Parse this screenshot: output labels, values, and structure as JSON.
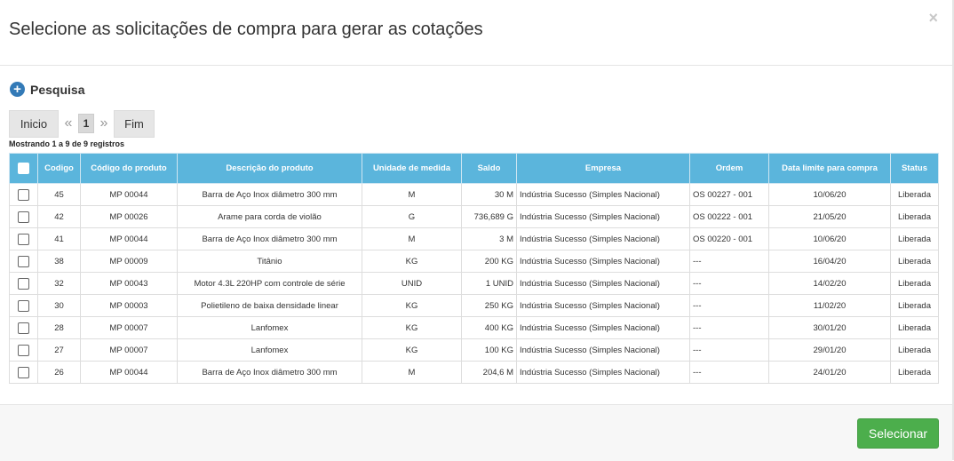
{
  "modal": {
    "title": "Selecione as solicitações de compra para gerar as cotações",
    "close_glyph": "×"
  },
  "search": {
    "label": "Pesquisa",
    "icon": "plus-circle-icon"
  },
  "pager": {
    "first_label": "Inicio",
    "prev_glyph": "«",
    "current_page": "1",
    "next_glyph": "»",
    "last_label": "Fim"
  },
  "showing_text": "Mostrando 1 a 9 de 9 registros",
  "table": {
    "columns": [
      "Codigo",
      "Código do produto",
      "Descrição do produto",
      "Unidade de medida",
      "Saldo",
      "Empresa",
      "Ordem",
      "Data limite para compra",
      "Status"
    ],
    "rows": [
      {
        "codigo": "45",
        "produto": "MP 00044",
        "descricao": "Barra de Aço Inox diâmetro 300 mm",
        "unidade": "M",
        "saldo": "30 M",
        "empresa": "Indústria Sucesso (Simples Nacional)",
        "ordem": "OS 00227 - 001",
        "data": "10/06/20",
        "status": "Liberada"
      },
      {
        "codigo": "42",
        "produto": "MP 00026",
        "descricao": "Arame para corda de violão",
        "unidade": "G",
        "saldo": "736,689 G",
        "empresa": "Indústria Sucesso (Simples Nacional)",
        "ordem": "OS 00222 - 001",
        "data": "21/05/20",
        "status": "Liberada"
      },
      {
        "codigo": "41",
        "produto": "MP 00044",
        "descricao": "Barra de Aço Inox diâmetro 300 mm",
        "unidade": "M",
        "saldo": "3 M",
        "empresa": "Indústria Sucesso (Simples Nacional)",
        "ordem": "OS 00220 - 001",
        "data": "10/06/20",
        "status": "Liberada"
      },
      {
        "codigo": "38",
        "produto": "MP 00009",
        "descricao": "Titânio",
        "unidade": "KG",
        "saldo": "200 KG",
        "empresa": "Indústria Sucesso (Simples Nacional)",
        "ordem": "---",
        "data": "16/04/20",
        "status": "Liberada"
      },
      {
        "codigo": "32",
        "produto": "MP 00043",
        "descricao": "Motor 4.3L 220HP com controle de série",
        "unidade": "UNID",
        "saldo": "1 UNID",
        "empresa": "Indústria Sucesso (Simples Nacional)",
        "ordem": "---",
        "data": "14/02/20",
        "status": "Liberada"
      },
      {
        "codigo": "30",
        "produto": "MP 00003",
        "descricao": "Polietileno de baixa densidade linear",
        "unidade": "KG",
        "saldo": "250 KG",
        "empresa": "Indústria Sucesso (Simples Nacional)",
        "ordem": "---",
        "data": "11/02/20",
        "status": "Liberada"
      },
      {
        "codigo": "28",
        "produto": "MP 00007",
        "descricao": "Lanfomex",
        "unidade": "KG",
        "saldo": "400 KG",
        "empresa": "Indústria Sucesso (Simples Nacional)",
        "ordem": "---",
        "data": "30/01/20",
        "status": "Liberada"
      },
      {
        "codigo": "27",
        "produto": "MP 00007",
        "descricao": "Lanfomex",
        "unidade": "KG",
        "saldo": "100 KG",
        "empresa": "Indústria Sucesso (Simples Nacional)",
        "ordem": "---",
        "data": "29/01/20",
        "status": "Liberada"
      },
      {
        "codigo": "26",
        "produto": "MP 00044",
        "descricao": "Barra de Aço Inox diâmetro 300 mm",
        "unidade": "M",
        "saldo": "204,6 M",
        "empresa": "Indústria Sucesso (Simples Nacional)",
        "ordem": "---",
        "data": "24/01/20",
        "status": "Liberada"
      }
    ]
  },
  "footer": {
    "select_label": "Selecionar"
  },
  "colors": {
    "header_bg": "#5bb5dc",
    "primary": "#337ab7",
    "success": "#4cae4c"
  }
}
